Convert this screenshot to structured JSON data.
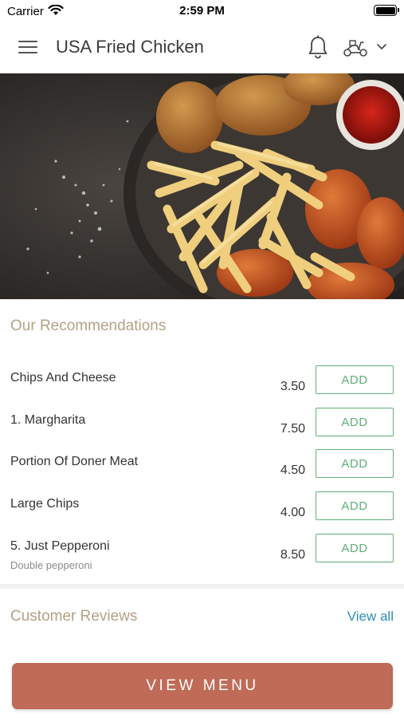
{
  "status_bar": {
    "carrier": "Carrier",
    "time": "2:59 PM"
  },
  "header": {
    "title": "USA Fried Chicken",
    "icons": [
      "menu-icon",
      "bell-icon",
      "scooter-icon",
      "chevron-down-icon"
    ]
  },
  "hero": {
    "image": "fried chicken and fries platter with ketchup dip"
  },
  "recommendations": {
    "title": "Our Recommendations",
    "items": [
      {
        "name": "Chips And Cheese",
        "description": "",
        "price": "3.50",
        "button": "ADD"
      },
      {
        "name": "1. Margharita",
        "description": "",
        "price": "7.50",
        "button": "ADD"
      },
      {
        "name": "Portion Of Doner Meat",
        "description": "",
        "price": "4.50",
        "button": "ADD"
      },
      {
        "name": "Large Chips",
        "description": "",
        "price": "4.00",
        "button": "ADD"
      },
      {
        "name": "5. Just Pepperoni",
        "description": "Double pepperoni",
        "price": "8.50",
        "button": "ADD"
      }
    ]
  },
  "reviews": {
    "title": "Customer Reviews",
    "view_all": "View all"
  },
  "footer": {
    "view_menu": "VIEW MENU"
  },
  "colors": {
    "accent": "#bf6b57",
    "section_title": "#b3a186",
    "add_button": "#5fae79",
    "link": "#2d8fb4"
  }
}
